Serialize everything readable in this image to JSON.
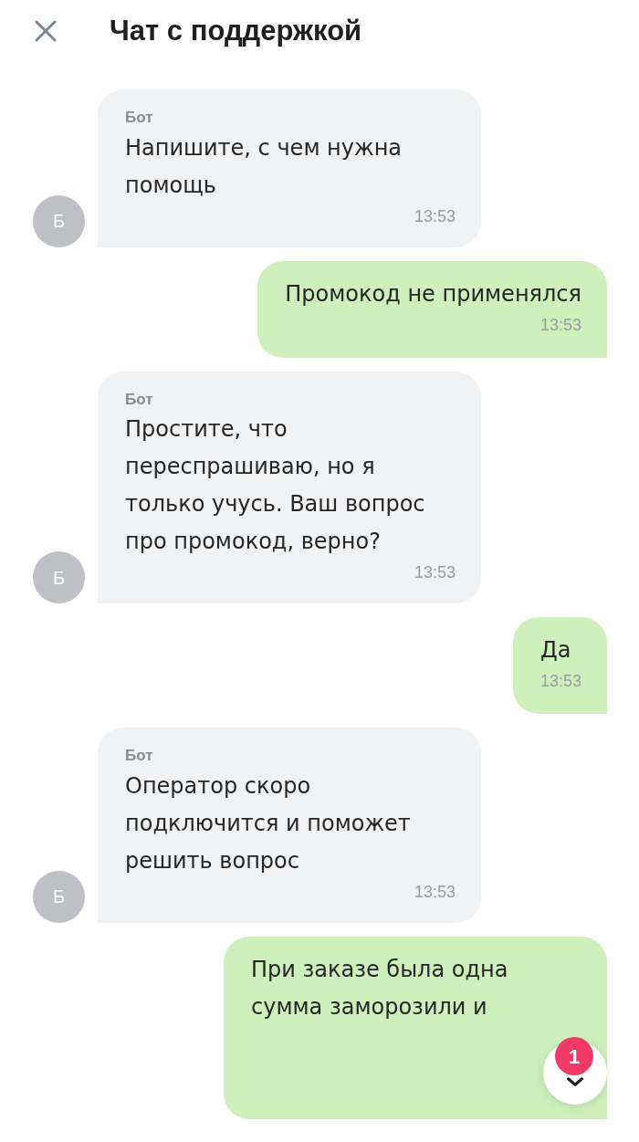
{
  "header": {
    "title": "Чат с поддержкой"
  },
  "messages": [
    {
      "kind": "bot",
      "sender": "Бот",
      "avatar": "Б",
      "text": "Напишите, с чем нужна помощь",
      "time": "13:53"
    },
    {
      "kind": "user",
      "text": "Промокод не применялся",
      "time": "13:53"
    },
    {
      "kind": "bot",
      "sender": "Бот",
      "avatar": "Б",
      "text": "Простите, что переспрашиваю, но я только учусь. Ваш вопрос про промокод, верно?",
      "time": "13:53"
    },
    {
      "kind": "user",
      "text": "Да",
      "time": "13:53"
    },
    {
      "kind": "bot",
      "sender": "Бот",
      "avatar": "Б",
      "text": "Оператор скоро подключится и поможет решить вопрос",
      "time": "13:53"
    },
    {
      "kind": "user",
      "text": "При заказе была одна сумма заморозили и"
    }
  ],
  "scroll_button": {
    "badge": "1"
  }
}
